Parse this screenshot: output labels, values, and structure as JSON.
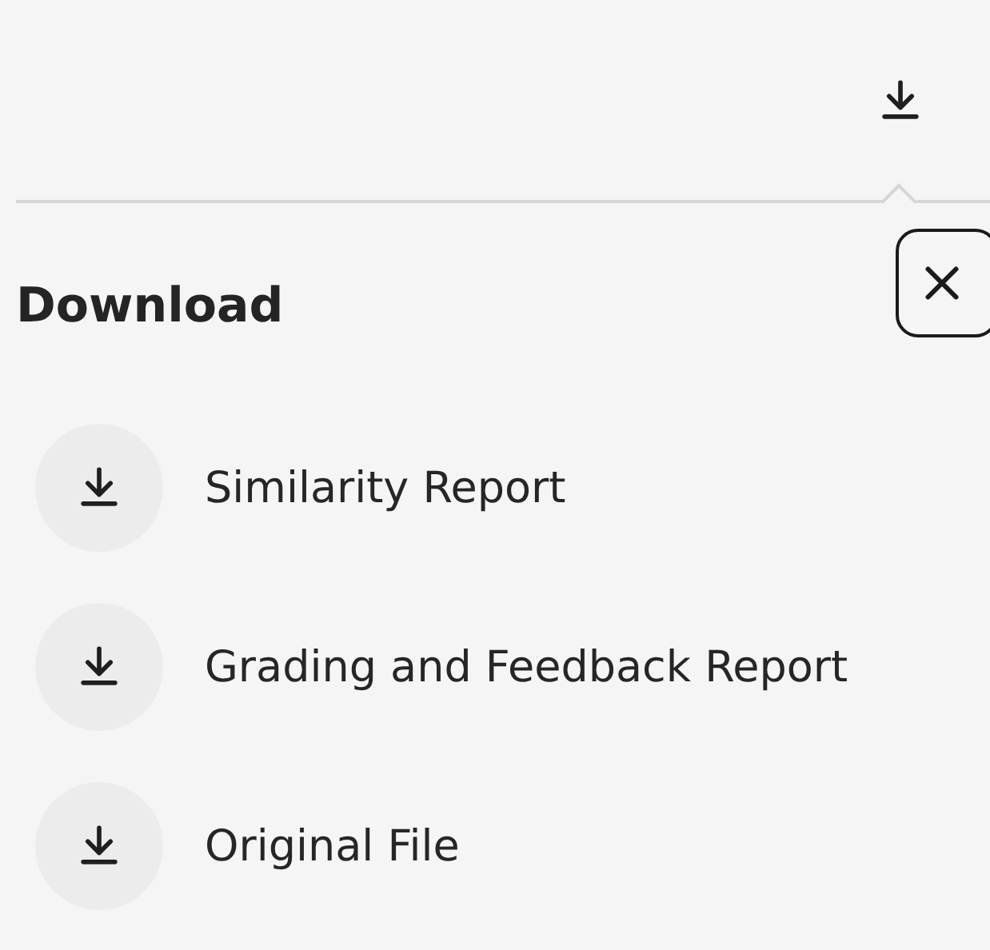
{
  "panel": {
    "title": "Download"
  },
  "items": [
    {
      "label": "Similarity Report"
    },
    {
      "label": "Grading and Feedback Report"
    },
    {
      "label": "Original File"
    }
  ]
}
